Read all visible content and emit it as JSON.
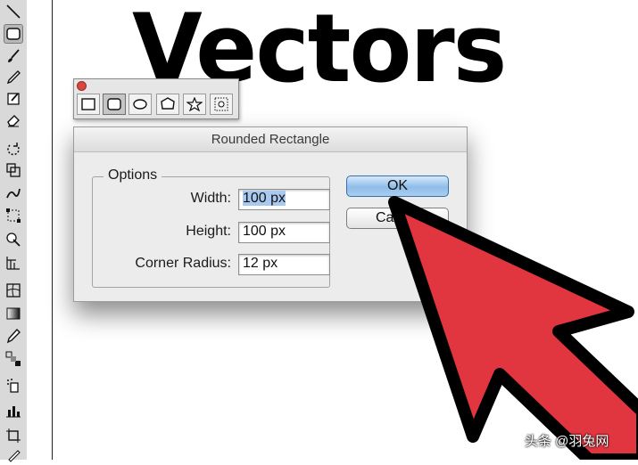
{
  "heading": "Vectors",
  "toolbar": {
    "tools": [
      {
        "icon": "line-segment-icon"
      },
      {
        "icon": "rounded-rectangle-icon",
        "selected": true
      },
      {
        "icon": "paintbrush-icon"
      },
      {
        "icon": "pencil-icon"
      },
      {
        "icon": "blob-brush-icon"
      },
      {
        "icon": "eraser-icon"
      },
      {
        "icon": "rotate-icon"
      },
      {
        "icon": "scale-icon"
      },
      {
        "icon": "warp-icon"
      },
      {
        "icon": "free-transform-icon"
      },
      {
        "icon": "shape-builder-icon"
      },
      {
        "icon": "perspective-grid-icon"
      },
      {
        "icon": "mesh-icon"
      },
      {
        "icon": "gradient-icon"
      },
      {
        "icon": "eyedropper-icon"
      },
      {
        "icon": "blend-icon"
      },
      {
        "icon": "symbol-sprayer-icon"
      },
      {
        "icon": "column-graph-icon"
      },
      {
        "icon": "artboard-icon"
      },
      {
        "icon": "slice-icon"
      }
    ]
  },
  "palette": {
    "items": [
      {
        "icon": "rectangle-tool-icon"
      },
      {
        "icon": "rounded-rectangle-tool-icon",
        "selected": true
      },
      {
        "icon": "ellipse-tool-icon"
      },
      {
        "icon": "polygon-tool-icon"
      },
      {
        "icon": "star-tool-icon"
      },
      {
        "icon": "flare-tool-icon"
      }
    ]
  },
  "dialog": {
    "title": "Rounded Rectangle",
    "group_label": "Options",
    "width_label": "Width:",
    "width_value": "100 px",
    "height_label": "Height:",
    "height_value": "100 px",
    "corner_radius_label": "Corner Radius:",
    "corner_radius_value": "12 px",
    "ok_label": "OK",
    "cancel_label": "Ca"
  },
  "annotation": {
    "arrow_color": "#e1353f",
    "arrow_outline": "#000000"
  },
  "watermark": "头条 @羽兔网"
}
